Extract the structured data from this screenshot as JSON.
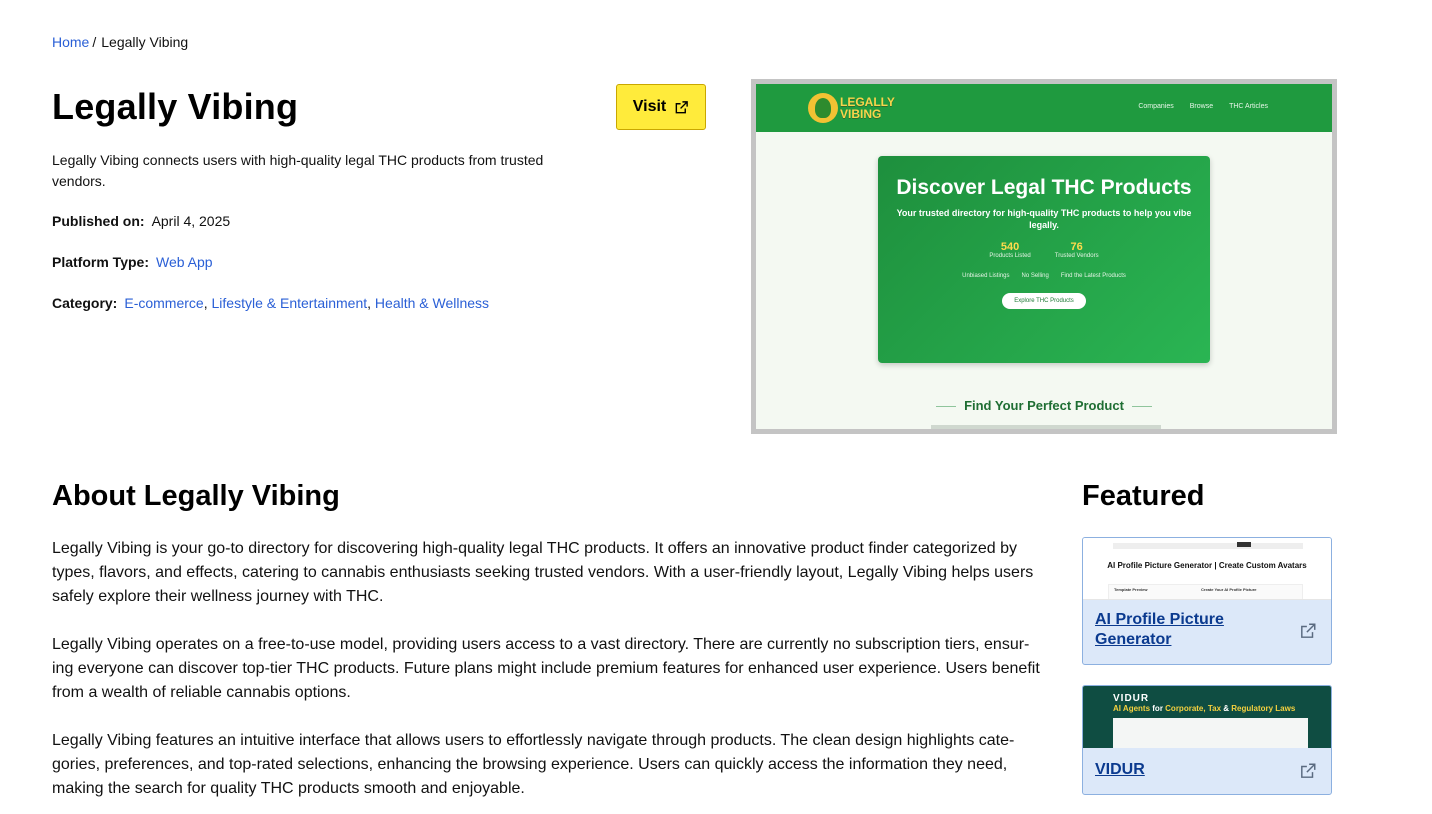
{
  "breadcrumb": {
    "home": "Home",
    "separator": "/",
    "current": "Legally Vibing"
  },
  "title": "Legally Vibing",
  "visit_label": "Visit",
  "description": "Legally Vibing connects users with high-quality legal THC products from trusted vendors.",
  "published": {
    "label": "Published on:",
    "value": "April 4, 2025"
  },
  "platform": {
    "label": "Platform Type:",
    "value": "Web App"
  },
  "category": {
    "label": "Category:",
    "items": [
      "E-commerce",
      "Lifestyle & Entertainment",
      "Health & Wellness"
    ],
    "separator": ","
  },
  "screenshot": {
    "logo_line1": "LEGALLY",
    "logo_line2": "VIBING",
    "nav": [
      "Companies",
      "Browse",
      "THC Articles"
    ],
    "hero_title": "Discover Legal THC Products",
    "hero_subtitle": "Your trusted directory for high-quality THC products to help you vibe legally.",
    "stats": [
      {
        "value": "540",
        "label": "Products Listed"
      },
      {
        "value": "76",
        "label": "Trusted Vendors"
      }
    ],
    "features": [
      "Unbiased Listings",
      "No Selling",
      "Find the Latest Products"
    ],
    "cta": "Explore THC Products",
    "section_title": "Find Your Perfect Product"
  },
  "about": {
    "heading": "About Legally Vibing",
    "paragraphs": [
      "Legally Vibing is your go-to directory for discovering high-quality legal THC products. It offers an innovative product finder categorized by types, flavors, and effects, catering to cannabis enthusiasts seeking trusted vendors. With a user-friendly layout, Legally Vibing helps users safely explore their wellness journey with THC.",
      "Legally Vibing operates on a free-to-use model, providing users access to a vast directory. There are currently no subscription tiers, ensur-ing everyone can discover top-tier THC products. Future plans might include premium features for enhanced user experience. Users benefit from a wealth of reliable cannabis options.",
      "Legally Vibing features an intuitive interface that allows users to effortlessly navigate through products. The clean design highlights cate-gories, preferences, and top-rated selections, enhancing the browsing experience. Users can quickly access the information they need, making the search for quality THC products smooth and enjoyable."
    ]
  },
  "featured": {
    "heading": "Featured",
    "cards": [
      {
        "title": "AI Profile Picture Generator",
        "thumb_heading": "AI Profile Picture Generator | Create Custom Avatars",
        "thumb_label_left": "Template Preview",
        "thumb_label_right": "Create Your AI Profile Picture"
      },
      {
        "title": "VIDUR",
        "thumb_logo": "VIDUR",
        "thumb_tag_a": "AI Agents",
        "thumb_tag_b": " for ",
        "thumb_tag_c": "Corporate, Tax",
        "thumb_tag_d": " & ",
        "thumb_tag_e": "Regulatory Laws"
      }
    ]
  },
  "colors": {
    "link": "#2a5fd6",
    "visit_button": "#ffeb3b",
    "card_bg": "#dce8f9",
    "hero_green": "#1f9a3f"
  }
}
